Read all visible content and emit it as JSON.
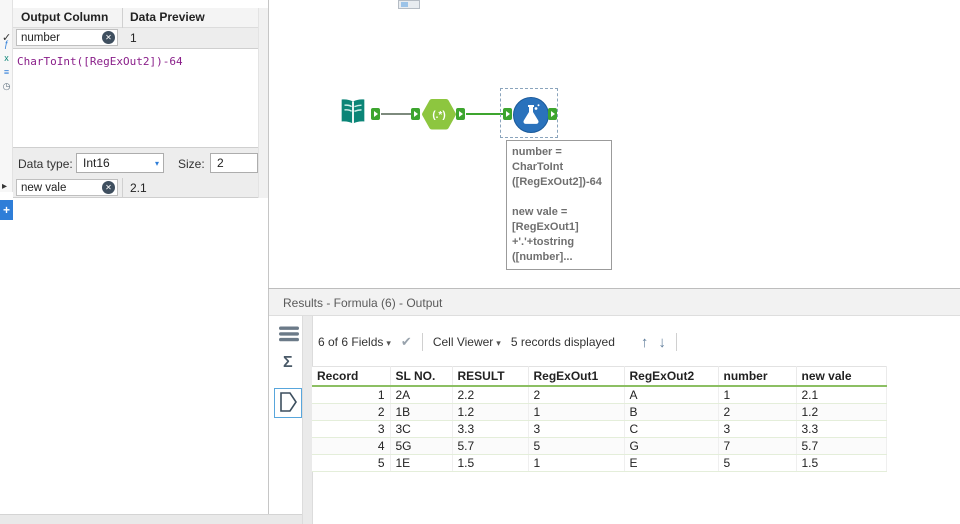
{
  "config": {
    "header": {
      "output_column": "Output Column",
      "data_preview": "Data Preview"
    },
    "rows": [
      {
        "name": "number",
        "preview": "1"
      },
      {
        "name": "new vale",
        "preview": "2.1"
      }
    ],
    "expression": "CharToInt([RegExOut2])-64",
    "data_type": {
      "label": "Data type:",
      "value": "Int16"
    },
    "size": {
      "label": "Size:",
      "value": "2"
    }
  },
  "canvas": {
    "regex_label": "(.*)",
    "annotation": [
      "number =",
      "CharToInt",
      "([RegExOut2])-64",
      "",
      "new vale =",
      "[RegExOut1]",
      "+'.'+tostring",
      "([number]..."
    ]
  },
  "results": {
    "title": "Results - Formula (6) - Output",
    "toolbar": {
      "fields": "6 of 6 Fields",
      "cell_viewer": "Cell Viewer",
      "records": "5 records displayed"
    },
    "table": {
      "columns": [
        "Record",
        "SL NO.",
        "RESULT",
        "RegExOut1",
        "RegExOut2",
        "number",
        "new vale"
      ],
      "rows": [
        [
          "1",
          "2A",
          "2.2",
          "2",
          "A",
          "1",
          "2.1"
        ],
        [
          "2",
          "1B",
          "1.2",
          "1",
          "B",
          "2",
          "1.2"
        ],
        [
          "3",
          "3C",
          "3.3",
          "3",
          "C",
          "3",
          "3.3"
        ],
        [
          "4",
          "5G",
          "5.7",
          "5",
          "G",
          "7",
          "5.7"
        ],
        [
          "5",
          "1E",
          "1.5",
          "1",
          "E",
          "5",
          "1.5"
        ]
      ]
    }
  },
  "icons": {
    "check": "✓",
    "row_marker": "▸",
    "close": "✕",
    "caret_down": "▾",
    "plus": "+",
    "check_big": "✔",
    "sigma": "Σ",
    "arrow_up": "↑",
    "arrow_down": "↓",
    "functions": "ƒ",
    "columns": "x",
    "constants": "≡",
    "recent": "◷"
  },
  "colors": {
    "accent_blue": "#2f7ed8",
    "tool_green": "#8dc63f",
    "tool_teal": "#0b8577",
    "tool_blue": "#2a72bc",
    "connection_green": "#3da52e",
    "header_green": "#8cbf63"
  }
}
